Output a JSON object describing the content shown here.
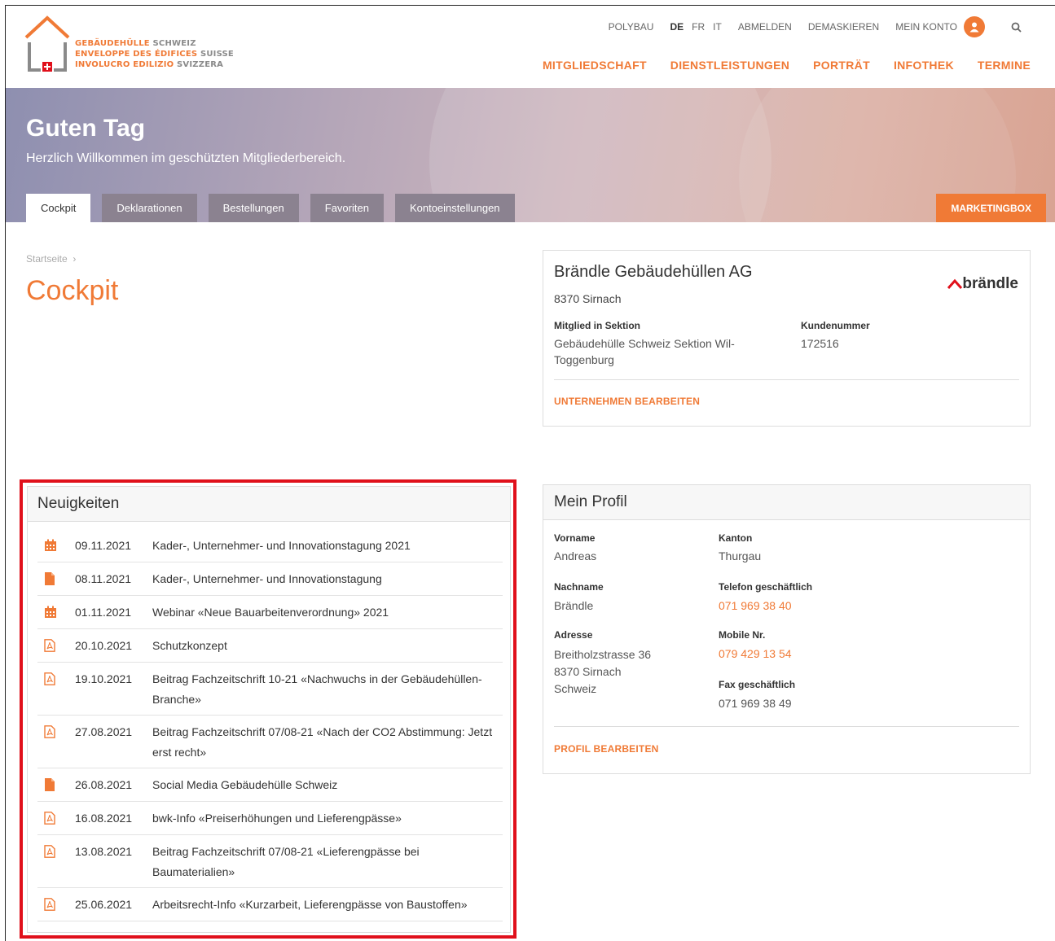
{
  "logo": {
    "line1": "GEBÄUDEHÜLLE",
    "line1b": "SCHWEIZ",
    "line2": "ENVELOPPE DES ÉDIFICES",
    "line2b": "SUISSE",
    "line3": "INVOLUCRO EDILIZIO",
    "line3b": "SVIZZERA"
  },
  "topnav": {
    "polybau": "POLYBAU",
    "langs": [
      "DE",
      "FR",
      "IT"
    ],
    "abmelden": "ABMELDEN",
    "demaskieren": "DEMASKIEREN",
    "konto": "MEIN KONTO"
  },
  "mainnav": [
    "MITGLIEDSCHAFT",
    "DIENSTLEISTUNGEN",
    "PORTRÄT",
    "INFOTHEK",
    "TERMINE"
  ],
  "hero": {
    "title": "Guten Tag",
    "subtitle": "Herzlich Willkommen im geschützten Mitgliederbereich."
  },
  "tabs": [
    "Cockpit",
    "Deklarationen",
    "Bestellungen",
    "Favoriten",
    "Kontoeinstellungen"
  ],
  "marketingbox": "MARKETINGBOX",
  "breadcrumb": "Startseite",
  "page_title": "Cockpit",
  "company": {
    "name": "Brändle Gebäudehüllen AG",
    "city": "8370 Sirnach",
    "sektion_label": "Mitglied in Sektion",
    "sektion_value": "Gebäudehülle Schweiz Sektion Wil-Toggenburg",
    "kunden_label": "Kundenummer",
    "kunden_value": "172516",
    "edit": "UNTERNEHMEN BEARBEITEN",
    "brand": "brändle"
  },
  "news": {
    "title": "Neuigkeiten",
    "items": [
      {
        "icon": "calendar-icon",
        "date": "09.11.2021",
        "text": "Kader-, Unternehmer- und Innovationstagung 2021"
      },
      {
        "icon": "document-icon",
        "date": "08.11.2021",
        "text": "Kader-, Unternehmer- und Innovationstagung"
      },
      {
        "icon": "calendar-icon",
        "date": "01.11.2021",
        "text": "Webinar «Neue Bauarbeitenverordnung» 2021"
      },
      {
        "icon": "pdf-icon",
        "date": "20.10.2021",
        "text": "Schutzkonzept"
      },
      {
        "icon": "pdf-icon",
        "date": "19.10.2021",
        "text": "Beitrag Fachzeitschrift 10-21 «Nachwuchs in der Gebäudehüllen-Branche»"
      },
      {
        "icon": "pdf-icon",
        "date": "27.08.2021",
        "text": "Beitrag Fachzeitschrift 07/08-21 «Nach der CO2 Abstimmung: Jetzt erst recht»"
      },
      {
        "icon": "document-icon",
        "date": "26.08.2021",
        "text": "Social Media Gebäudehülle Schweiz"
      },
      {
        "icon": "pdf-icon",
        "date": "16.08.2021",
        "text": "bwk-Info «Preiserhöhungen und Lieferengpässe»"
      },
      {
        "icon": "pdf-icon",
        "date": "13.08.2021",
        "text": "Beitrag Fachzeitschrift 07/08-21 «Lieferengpässe bei Baumaterialien»"
      },
      {
        "icon": "pdf-icon",
        "date": "25.06.2021",
        "text": "Arbeitsrecht-Info «Kurzarbeit, Lieferengpässe von Baustoffen»"
      }
    ]
  },
  "profile": {
    "title": "Mein Profil",
    "vorname_label": "Vorname",
    "vorname": "Andreas",
    "kanton_label": "Kanton",
    "kanton": "Thurgau",
    "nachname_label": "Nachname",
    "nachname": "Brändle",
    "tel_label": "Telefon geschäftlich",
    "tel": "071 969 38 40",
    "adresse_label": "Adresse",
    "adresse": [
      "Breitholzstrasse 36",
      "8370 Sirnach",
      "Schweiz"
    ],
    "mobile_label": "Mobile Nr.",
    "mobile": "079 429 13 54",
    "fax_label": "Fax geschäftlich",
    "fax": "071 969 38 49",
    "edit": "PROFIL BEARBEITEN"
  },
  "colors": {
    "accent": "#f07a36",
    "highlight": "#e0101b",
    "tab": "#8b8290"
  }
}
